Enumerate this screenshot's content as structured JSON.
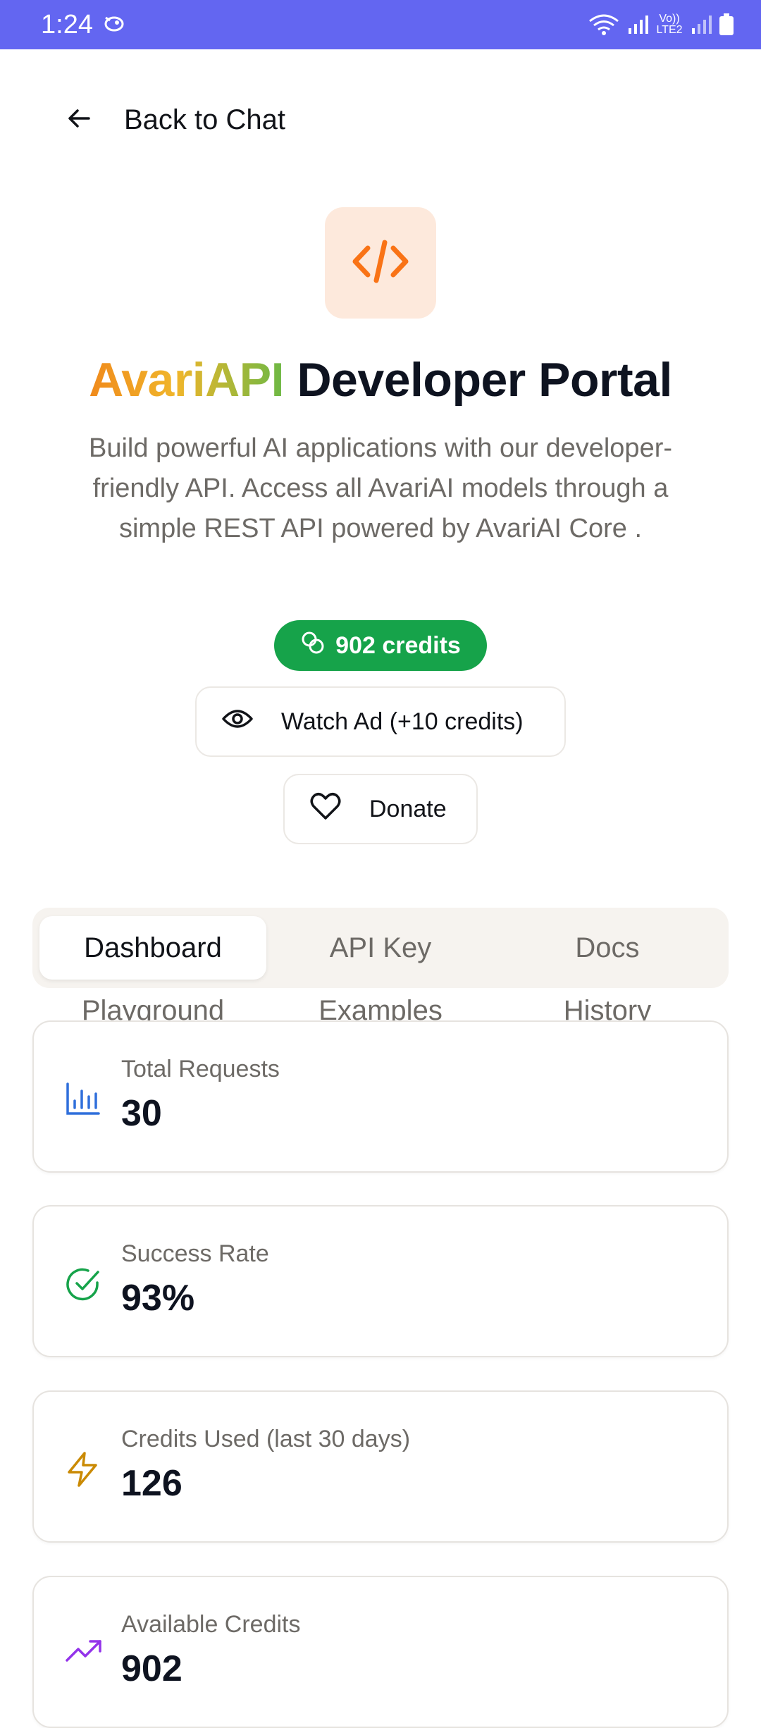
{
  "status_bar": {
    "time": "1:24",
    "right_text": "Vo)) LTE2"
  },
  "nav": {
    "back_label": "Back to Chat"
  },
  "header": {
    "title_brand": "AvariAPI",
    "title_rest": "Developer Portal",
    "subtitle": "Build powerful AI applications with our developer-friendly API. Access all AvariAI models through a simple REST API powered by AvariAI Core ."
  },
  "credits": {
    "badge_label": "902 credits"
  },
  "actions": {
    "watch_ad_label": "Watch Ad (+10 credits)",
    "donate_label": "Donate"
  },
  "tabs": {
    "row1": [
      "Dashboard",
      "API Key",
      "Docs"
    ],
    "row2": [
      "Playground",
      "Examples",
      "History"
    ],
    "active": "Dashboard"
  },
  "stats": [
    {
      "label": "Total Requests",
      "value": "30",
      "icon": "bar-chart-icon",
      "color": "#2f6fdb"
    },
    {
      "label": "Success Rate",
      "value": "93%",
      "icon": "check-circle-icon",
      "color": "#16a34a"
    },
    {
      "label": "Credits Used (last 30 days)",
      "value": "126",
      "icon": "lightning-icon",
      "color": "#ca8a04"
    },
    {
      "label": "Available Credits",
      "value": "902",
      "icon": "trending-up-icon",
      "color": "#9333ea"
    }
  ],
  "colors": {
    "status_bar": "#6366f1",
    "accent_orange": "#f97316",
    "credits_green": "#16a34a"
  }
}
